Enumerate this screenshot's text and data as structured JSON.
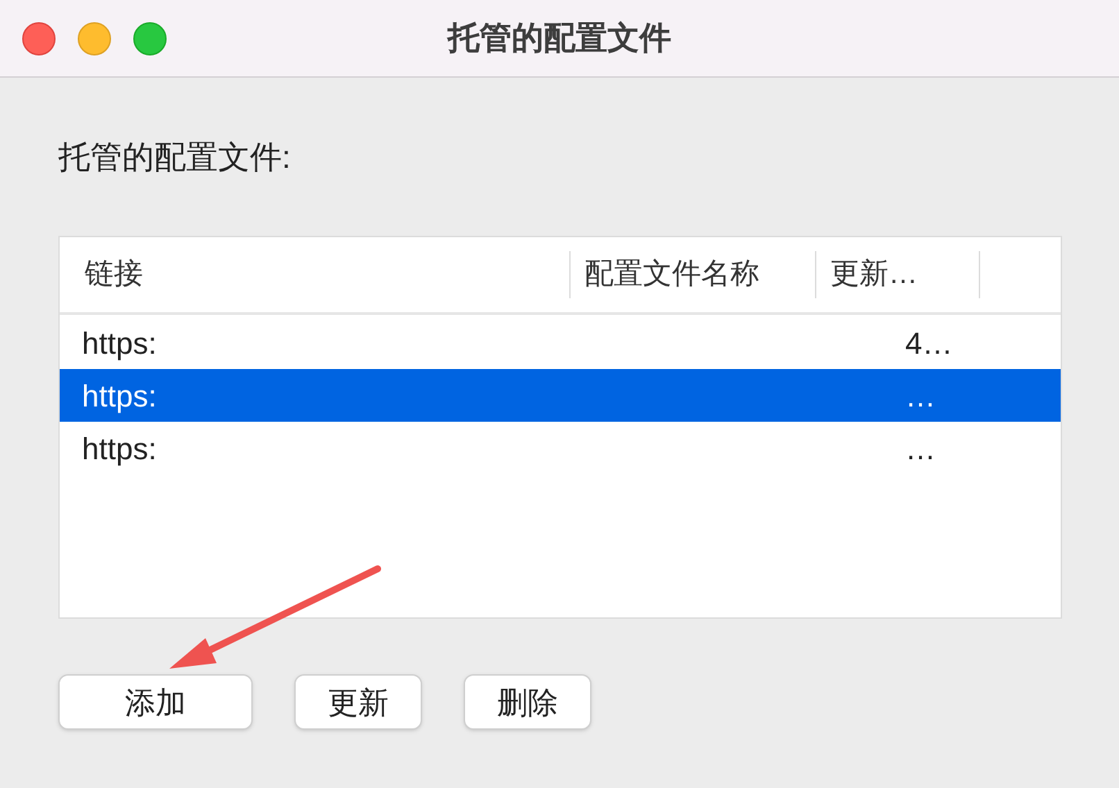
{
  "window": {
    "title": "托管的配置文件"
  },
  "heading": "托管的配置文件:",
  "table": {
    "columns": [
      "链接",
      "配置文件名称",
      "更新…"
    ],
    "rows": [
      {
        "link": "https:",
        "updated": "4…",
        "selected": false
      },
      {
        "link": "https:",
        "updated": "…",
        "selected": true
      },
      {
        "link": "https:",
        "updated": "…",
        "selected": false
      }
    ]
  },
  "buttons": [
    "添加",
    "更新",
    "删除"
  ]
}
